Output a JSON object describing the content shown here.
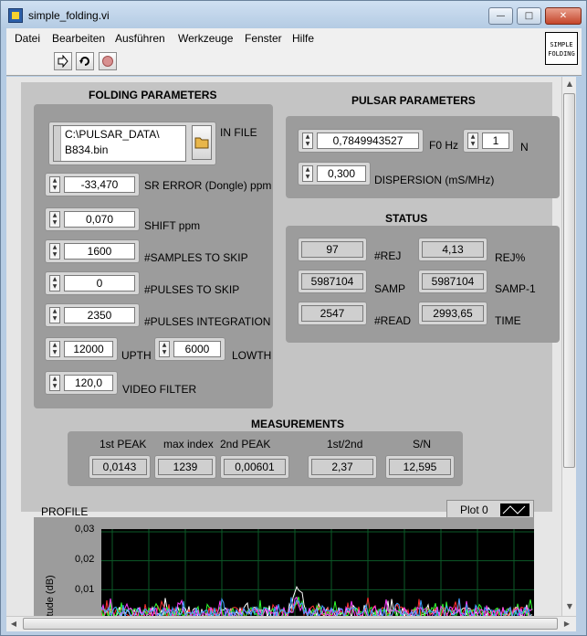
{
  "window": {
    "title": "simple_folding.vi"
  },
  "menu": [
    "Datei",
    "Bearbeiten",
    "Ausführen",
    "Werkzeuge",
    "Fenster",
    "Hilfe"
  ],
  "vi_icon": {
    "line1": "SIMPLE",
    "line2": "FOLDING"
  },
  "folding": {
    "header": "FOLDING PARAMETERS",
    "in_file": {
      "line1": "C:\\PULSAR_DATA\\",
      "line2": "B834.bin",
      "label": "IN FILE"
    },
    "sr_error": {
      "value": "-33,470",
      "label": "SR ERROR (Dongle) ppm"
    },
    "shift": {
      "value": "0,070",
      "label": "SHIFT ppm"
    },
    "samples_skip": {
      "value": "1600",
      "label": "#SAMPLES TO SKIP"
    },
    "pulses_skip": {
      "value": "0",
      "label": "#PULSES TO SKIP"
    },
    "pulses_integration": {
      "value": "2350",
      "label": "#PULSES INTEGRATION"
    },
    "upth": {
      "value": "12000",
      "label": "UPTH"
    },
    "lowth": {
      "value": "6000",
      "label": "LOWTH"
    },
    "video_filter": {
      "value": "120,0",
      "label": "VIDEO FILTER"
    }
  },
  "pulsar": {
    "header": "PULSAR PARAMETERS",
    "f0": {
      "value": "0,7849943527",
      "label": "F0 Hz"
    },
    "n": {
      "value": "1",
      "label": "N"
    },
    "dispersion": {
      "value": "0,300",
      "label": "DISPERSION (mS/MHz)"
    }
  },
  "status": {
    "header": "STATUS",
    "rej": {
      "value": "97",
      "label": "#REJ"
    },
    "rej_pct": {
      "value": "4,13",
      "label": "REJ%"
    },
    "samp": {
      "value": "5987104",
      "label": "SAMP"
    },
    "samp1": {
      "value": "5987104",
      "label": "SAMP-1"
    },
    "read": {
      "value": "2547",
      "label": "#READ"
    },
    "time": {
      "value": "2993,65",
      "label": "TIME"
    }
  },
  "measurements": {
    "header": "MEASUREMENTS",
    "first_peak": {
      "label": "1st PEAK",
      "value": "0,0143"
    },
    "max_index": {
      "label": "max index",
      "value": "1239"
    },
    "second_peak": {
      "label": "2nd PEAK",
      "value": "0,00601"
    },
    "ratio": {
      "label": "1st/2nd",
      "value": "2,37"
    },
    "sn": {
      "label": "S/N",
      "value": "12,595"
    }
  },
  "profile": {
    "title": "PROFILE",
    "legend": "Plot 0",
    "ylabel": "itude (dB)",
    "y_ticks": [
      "0,03",
      "0,02",
      "0,01"
    ]
  },
  "chart_data": {
    "type": "line",
    "title": "PROFILE",
    "ylabel": "itude (dB)",
    "ylim": [
      0,
      0.03
    ],
    "y_ticks": [
      0.03,
      0.02,
      0.01
    ],
    "series": [
      {
        "name": "Plot 0",
        "peak_value": 0.0143,
        "peak_index": 1239
      }
    ],
    "grid": true
  }
}
